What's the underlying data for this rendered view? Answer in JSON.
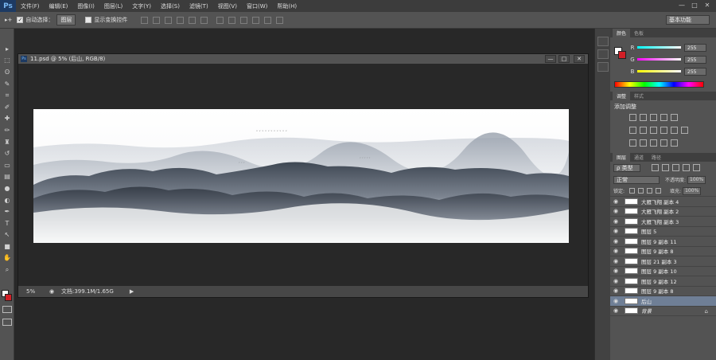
{
  "app": {
    "logo": "Ps"
  },
  "menubar": {
    "items": [
      "文件(F)",
      "编辑(E)",
      "图像(I)",
      "图层(L)",
      "文字(Y)",
      "选择(S)",
      "滤镜(T)",
      "视图(V)",
      "窗口(W)",
      "帮助(H)"
    ]
  },
  "window_controls": {
    "minimize": "—",
    "maximize": "□",
    "close": "✕"
  },
  "options": {
    "move_tool_glyph": "▸+",
    "auto_select_label": "自动选择：",
    "auto_select_checked": true,
    "auto_select_target": "图层",
    "show_transform_label": "显示变换控件",
    "show_transform_checked": false,
    "workspace": "基本功能"
  },
  "toolbar": {
    "tools": [
      "move-tool",
      "marquee-tool",
      "lasso-tool",
      "quick-select-tool",
      "crop-tool",
      "eyedropper-tool",
      "healing-tool",
      "brush-tool",
      "stamp-tool",
      "history-brush-tool",
      "eraser-tool",
      "gradient-tool",
      "blur-tool",
      "dodge-tool",
      "pen-tool",
      "type-tool",
      "path-select-tool",
      "shape-tool",
      "hand-tool",
      "zoom-tool"
    ],
    "glyphs": [
      "▸",
      "⬚",
      "ʘ",
      "✎",
      "⌗",
      "✐",
      "✚",
      "✏",
      "♜",
      "↺",
      "▭",
      "▤",
      "●",
      "◐",
      "✒",
      "T",
      "↖",
      "■",
      "✋",
      "⌕"
    ],
    "foreground_color": "#ffffff",
    "background_color": "#d21f26"
  },
  "document": {
    "title": "11.psd @ 5% (后山, RGB/8)",
    "zoom": "5%",
    "doc_size": "文档:399.1M/1.65G"
  },
  "color_panel": {
    "tabs": [
      "颜色",
      "色板"
    ],
    "channels": [
      {
        "label": "R",
        "value": "255",
        "gradient": "linear-gradient(to right,#00ffff,#ffffff)"
      },
      {
        "label": "G",
        "value": "255",
        "gradient": "linear-gradient(to right,#ff00ff,#ffffff)"
      },
      {
        "label": "B",
        "value": "255",
        "gradient": "linear-gradient(to right,#ffff00,#ffffff)"
      }
    ]
  },
  "adjust_panel": {
    "tabs": [
      "调整",
      "样式"
    ],
    "title": "添加调整"
  },
  "layers_panel": {
    "tabs": [
      "图层",
      "通道",
      "路径"
    ],
    "kind_filter": "ρ 类型",
    "blend_mode": "正常",
    "opacity_label": "不透明度:",
    "opacity": "100%",
    "lock_label": "锁定:",
    "fill_label": "填充:",
    "fill": "100%",
    "layers": [
      {
        "name": "大雁飞翔 副本 4",
        "selected": false
      },
      {
        "name": "大雁飞翔 副本 2",
        "selected": false
      },
      {
        "name": "大雁飞翔 副本 3",
        "selected": false
      },
      {
        "name": "图层 5",
        "selected": false
      },
      {
        "name": "图层 9 副本 11",
        "selected": false
      },
      {
        "name": "图层 9 副本 8",
        "selected": false
      },
      {
        "name": "图层 21 副本 3",
        "selected": false
      },
      {
        "name": "图层 9 副本 10",
        "selected": false
      },
      {
        "name": "图层 9 副本 12",
        "selected": false
      },
      {
        "name": "图层 9 副本 8",
        "selected": false
      },
      {
        "name": "后山",
        "selected": true
      },
      {
        "name": "背景",
        "selected": false,
        "locked": true
      }
    ]
  }
}
